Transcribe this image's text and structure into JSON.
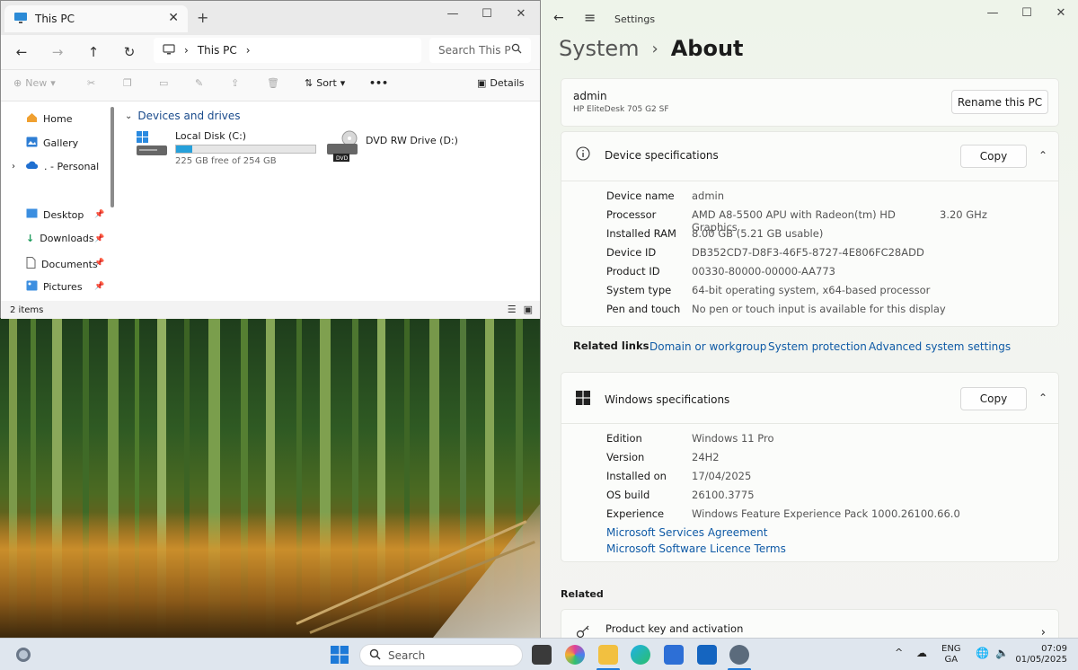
{
  "explorer": {
    "tab_title": "This PC",
    "address": "This PC",
    "search_placeholder": "Search This P",
    "toolbar": {
      "new": "New",
      "sort": "Sort",
      "more": "•••",
      "details": "Details"
    },
    "nav": {
      "home": "Home",
      "gallery": "Gallery",
      "personal": ". - Personal",
      "desktop": "Desktop",
      "downloads": "Downloads",
      "documents": "Documents",
      "pictures": "Pictures"
    },
    "group_title": "Devices and drives",
    "drives": [
      {
        "name": "Local Disk (C:)",
        "free": "225 GB free of 254 GB",
        "used_fraction": 0.114
      },
      {
        "name": "DVD RW Drive (D:)",
        "label": "DVD"
      }
    ],
    "status": "2 items"
  },
  "settings": {
    "app_title": "Settings",
    "crumb_parent": "System",
    "crumb_current": "About",
    "pc_name": "admin",
    "pc_model": "HP EliteDesk 705 G2 SF",
    "rename_button": "Rename this PC",
    "device_spec_title": "Device specifications",
    "copy_label": "Copy",
    "device_specs": [
      {
        "key": "Device name",
        "value": "admin"
      },
      {
        "key": "Processor",
        "value": "AMD A8-5500 APU with Radeon(tm) HD Graphics",
        "extra": "3.20 GHz"
      },
      {
        "key": "Installed RAM",
        "value": "8.00 GB (5.21 GB usable)"
      },
      {
        "key": "Device ID",
        "value": "DB352CD7-D8F3-46F5-8727-4E806FC28ADD"
      },
      {
        "key": "Product ID",
        "value": "00330-80000-00000-AA773"
      },
      {
        "key": "System type",
        "value": "64-bit operating system, x64-based processor"
      },
      {
        "key": "Pen and touch",
        "value": "No pen or touch input is available for this display"
      }
    ],
    "related_links_label": "Related links",
    "related_links": [
      "Domain or workgroup",
      "System protection",
      "Advanced system settings"
    ],
    "windows_spec_title": "Windows specifications",
    "windows_specs": [
      {
        "key": "Edition",
        "value": "Windows 11 Pro"
      },
      {
        "key": "Version",
        "value": "24H2"
      },
      {
        "key": "Installed on",
        "value": "17/04/2025"
      },
      {
        "key": "OS build",
        "value": "26100.3775"
      },
      {
        "key": "Experience",
        "value": "Windows Feature Experience Pack 1000.26100.66.0"
      }
    ],
    "ms_links": [
      "Microsoft Services Agreement",
      "Microsoft Software Licence Terms"
    ],
    "related_title": "Related",
    "product_key": "Product key and activation"
  },
  "taskbar": {
    "search": "Search",
    "lang_top": "ENG",
    "lang_bottom": "GA",
    "time": "07:09",
    "date": "01/05/2025"
  },
  "colors": {
    "accent": "#0f5aa6",
    "drive_bar": "#26a0da"
  }
}
